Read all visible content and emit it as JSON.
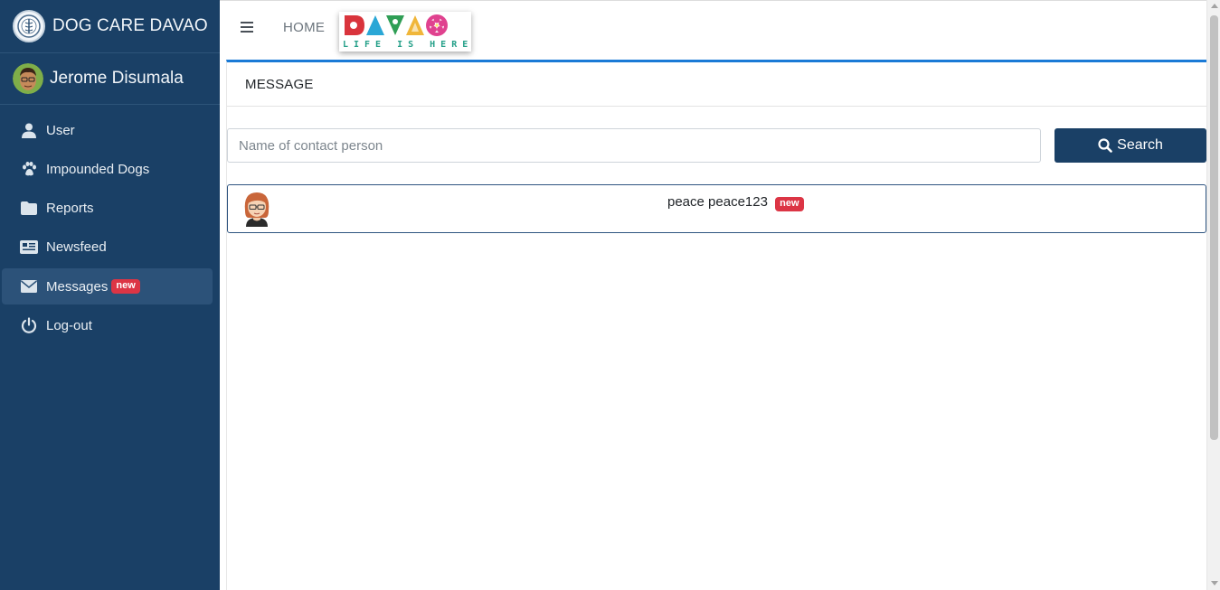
{
  "sidebar": {
    "brand_title": "DOG CARE DAVAO",
    "user_name": "Jerome Disumala",
    "items": [
      {
        "label": "User",
        "icon": "user-icon",
        "active": false
      },
      {
        "label": "Impounded Dogs",
        "icon": "paw-icon",
        "active": false
      },
      {
        "label": "Reports",
        "icon": "folder-icon",
        "active": false
      },
      {
        "label": "Newsfeed",
        "icon": "newspaper-icon",
        "active": false
      },
      {
        "label": "Messages",
        "icon": "envelope-icon",
        "active": true,
        "badge": "new"
      },
      {
        "label": "Log-out",
        "icon": "power-icon",
        "active": false
      }
    ]
  },
  "header": {
    "home_label": "HOME",
    "logo_text": "DAVAO",
    "logo_tagline": "LIFE IS HERE"
  },
  "main": {
    "title": "MESSAGE",
    "search": {
      "placeholder": "Name of contact person",
      "value": "",
      "button_label": "Search"
    },
    "contacts": [
      {
        "name": "peace peace123",
        "badge": "new"
      }
    ]
  },
  "colors": {
    "sidebar_bg": "#1a4066",
    "active_item_bg": "#2c5279",
    "accent_blue": "#1a7ad6",
    "badge_red": "#dc3545",
    "button_bg": "#1a4066"
  }
}
